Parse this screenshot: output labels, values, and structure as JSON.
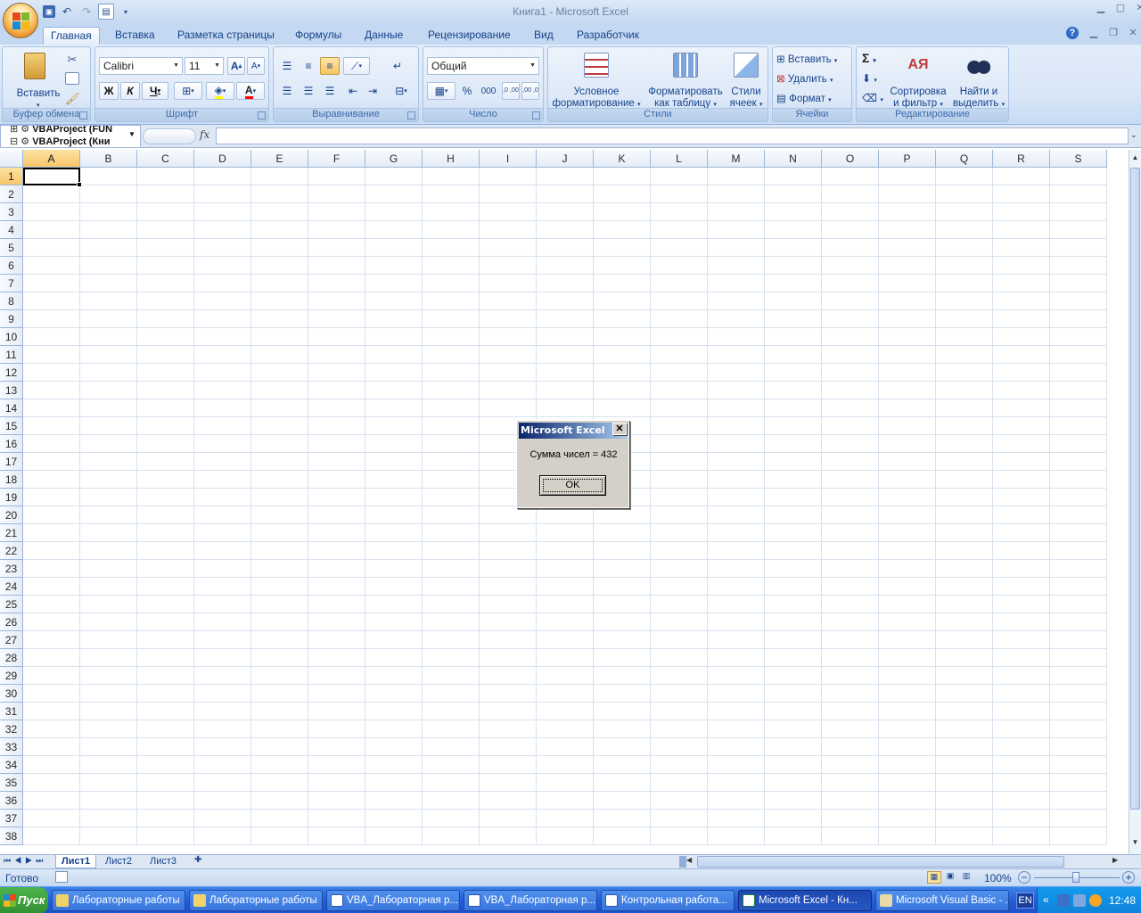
{
  "window": {
    "title": "Книга1 - Microsoft Excel"
  },
  "ribbon_tabs": [
    "Главная",
    "Вставка",
    "Разметка страницы",
    "Формулы",
    "Данные",
    "Рецензирование",
    "Вид",
    "Разработчик"
  ],
  "ribbon": {
    "clipboard": {
      "label": "Буфер обмена",
      "paste": "Вставить"
    },
    "font": {
      "label": "Шрифт",
      "name": "Calibri",
      "size": "11",
      "bold": "Ж",
      "italic": "К",
      "underline": "Ч",
      "grow": "A",
      "shrink": "A",
      "color_letter": "A"
    },
    "alignment": {
      "label": "Выравнивание"
    },
    "number": {
      "label": "Число",
      "format": "Общий",
      "percent": "%",
      "thousands": "000",
      "inc_decimals": ",0 ,00",
      "dec_decimals": ",00 ,0"
    },
    "styles": {
      "label": "Стили",
      "conditional_1": "Условное",
      "conditional_2": "форматирование",
      "astable_1": "Форматировать",
      "astable_2": "как таблицу",
      "cellstyles_1": "Стили",
      "cellstyles_2": "ячеек"
    },
    "cells": {
      "label": "Ячейки",
      "insert": "Вставить",
      "delete": "Удалить",
      "format": "Формат"
    },
    "editing": {
      "label": "Редактирование",
      "sum": "Σ",
      "sort_1": "Сортировка",
      "sort_2": "и фильтр",
      "find_1": "Найти и",
      "find_2": "выделить"
    }
  },
  "namebox": {
    "line1": "VBAProject (FUN",
    "line2": "VBAProject (Кни"
  },
  "formula_bar": {
    "fx": "fx",
    "value": ""
  },
  "columns": [
    "A",
    "B",
    "C",
    "D",
    "E",
    "F",
    "G",
    "H",
    "I",
    "J",
    "K",
    "L",
    "M",
    "N",
    "O",
    "P",
    "Q",
    "R",
    "S"
  ],
  "rows": [
    "1",
    "2",
    "3",
    "4",
    "5",
    "6",
    "7",
    "8",
    "9",
    "10",
    "11",
    "12",
    "13",
    "14",
    "15",
    "16",
    "17",
    "18",
    "19",
    "20",
    "21",
    "22",
    "23",
    "24",
    "25",
    "26",
    "27",
    "28",
    "29",
    "30",
    "31",
    "32",
    "33",
    "34",
    "35",
    "36",
    "37",
    "38"
  ],
  "active_cell": "A1",
  "sheets": [
    "Лист1",
    "Лист2",
    "Лист3"
  ],
  "status": {
    "ready": "Готово",
    "zoom": "100%"
  },
  "dialog": {
    "title": "Microsoft Excel",
    "message": "Сумма чисел =  432",
    "ok": "OK",
    "close": "✕"
  },
  "taskbar": {
    "start": "Пуск",
    "buttons": [
      "Лабораторные работы",
      "Лабораторные работы",
      "VBA_Лабораторная р...",
      "VBA_Лабораторная р...",
      "Контрольная работа...",
      "Microsoft Excel - Кн...",
      "Microsoft Visual Basic - ..."
    ],
    "lang": "EN",
    "time": "12:48"
  }
}
